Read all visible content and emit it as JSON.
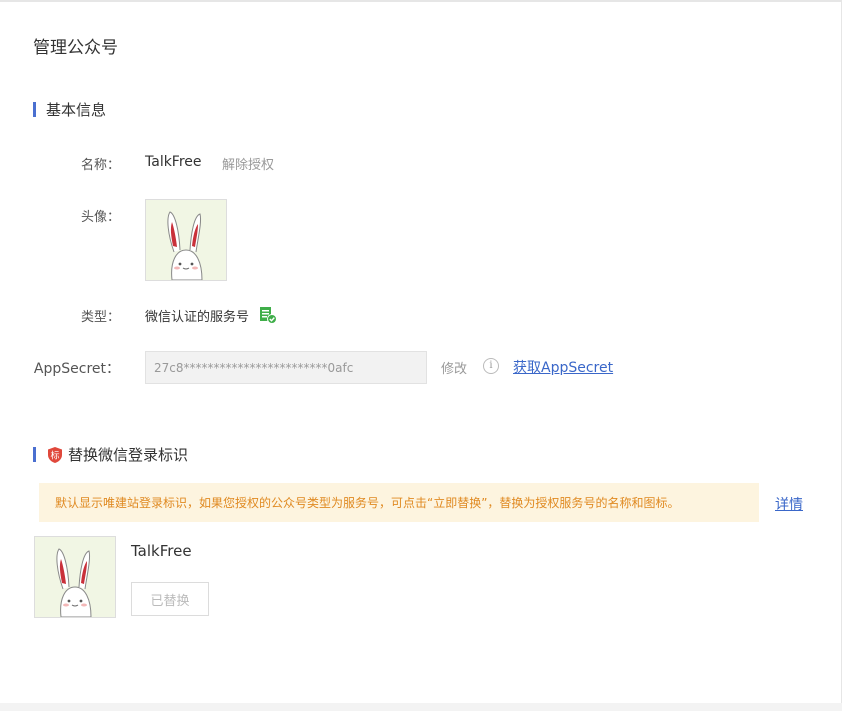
{
  "page": {
    "title": "管理公众号"
  },
  "basic_info": {
    "section_title": "基本信息",
    "name_label": "名称：",
    "name_value": "TalkFree",
    "unauthorize_link": "解除授权",
    "avatar_label": "头像：",
    "type_label": "类型：",
    "type_value": "微信认证的服务号",
    "appsecret_label": "AppSecret：",
    "appsecret_value": "27c8************************0afc",
    "modify_link": "修改",
    "info_glyph": "i",
    "get_appsecret_link": "获取AppSecret"
  },
  "replace_login": {
    "section_title": "替换微信登录标识",
    "badge_text": "标",
    "notice_text": "默认显示唯建站登录标识，如果您授权的公众号类型为服务号，可点击“立即替换”，替换为授权服务号的名称和图标。",
    "details_link": "详情",
    "account_name": "TalkFree",
    "replaced_button": "已替换"
  },
  "colors": {
    "accent_blue": "#4a6fd0",
    "link_blue": "#3a67c9",
    "notice_bg": "#fdf4df",
    "notice_text": "#e08a22",
    "badge_red": "#e0483b",
    "verified_green": "#3fae49"
  },
  "icons": {
    "verified": "verified-service-icon",
    "info": "info-icon",
    "badge": "shield-badge-icon",
    "avatar": "rabbit-avatar"
  }
}
